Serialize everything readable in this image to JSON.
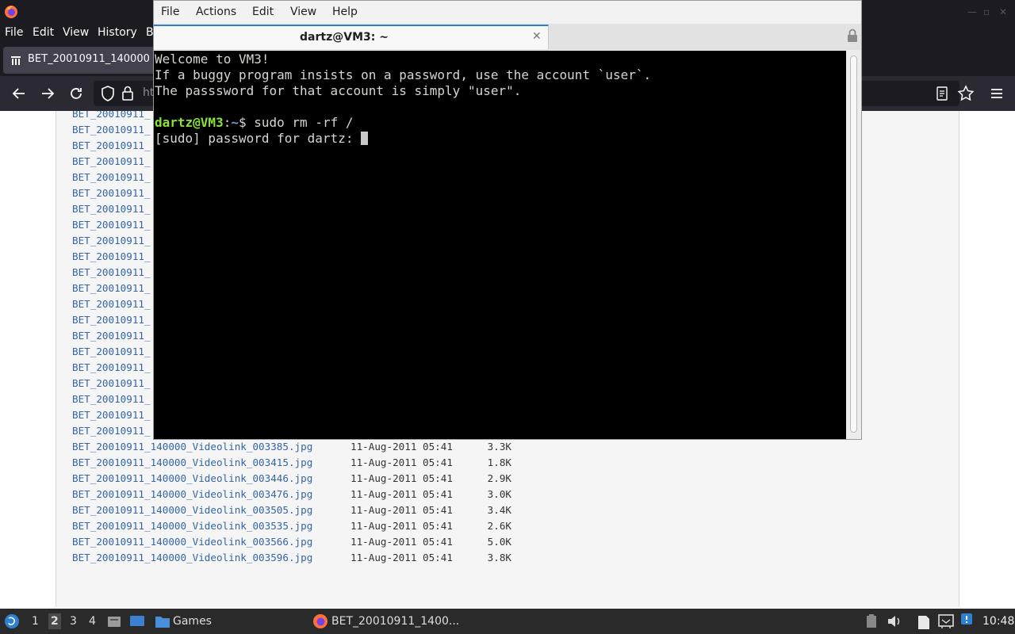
{
  "firefox": {
    "menu": [
      "File",
      "Edit",
      "View",
      "History",
      "B"
    ],
    "tab_title": "BET_20010911_140000",
    "url_partial": "ht"
  },
  "listing": {
    "hidden_rows_name": "BET_20010911_",
    "hidden_row_count": 21,
    "rows": [
      {
        "name": "BET_20010911_140000_Videolink_003385.jpg",
        "date": "11-Aug-2011 05:41",
        "size": "3.3K"
      },
      {
        "name": "BET_20010911_140000_Videolink_003415.jpg",
        "date": "11-Aug-2011 05:41",
        "size": "1.8K"
      },
      {
        "name": "BET_20010911_140000_Videolink_003446.jpg",
        "date": "11-Aug-2011 05:41",
        "size": "2.9K"
      },
      {
        "name": "BET_20010911_140000_Videolink_003476.jpg",
        "date": "11-Aug-2011 05:41",
        "size": "3.0K"
      },
      {
        "name": "BET_20010911_140000_Videolink_003505.jpg",
        "date": "11-Aug-2011 05:41",
        "size": "3.4K"
      },
      {
        "name": "BET_20010911_140000_Videolink_003535.jpg",
        "date": "11-Aug-2011 05:41",
        "size": "2.6K"
      },
      {
        "name": "BET_20010911_140000_Videolink_003566.jpg",
        "date": "11-Aug-2011 05:41",
        "size": "5.0K"
      },
      {
        "name": "BET_20010911_140000_Videolink_003596.jpg",
        "date": "11-Aug-2011 05:41",
        "size": "3.8K"
      }
    ]
  },
  "terminal": {
    "menu": {
      "file": "File",
      "actions": "Actions",
      "edit": "Edit",
      "view": "View",
      "help": "Help"
    },
    "tab_title": "dartz@VM3: ~",
    "lines": {
      "welcome": "Welcome to VM3!",
      "line2": "If a buggy program insists on a password, use the account `user`.",
      "line3": "The passsword for that account is simply \"user\".",
      "prompt_user": "dartz@VM3",
      "prompt_sep": ":",
      "prompt_path": "~",
      "prompt_cmd": "$ sudo rm -rf /",
      "sudo_prompt": "[sudo] password for dartz: "
    }
  },
  "taskbar": {
    "workspaces": [
      "1",
      "2",
      "3",
      "4"
    ],
    "games": "Games",
    "firefox_task": "BET_20010911_1400...",
    "clock": "10:48"
  },
  "colors": {
    "link": "#3465a4",
    "prompt_user": "#8ae234",
    "prompt_path": "#729fcf",
    "tab_accent": "#2f80d0"
  }
}
